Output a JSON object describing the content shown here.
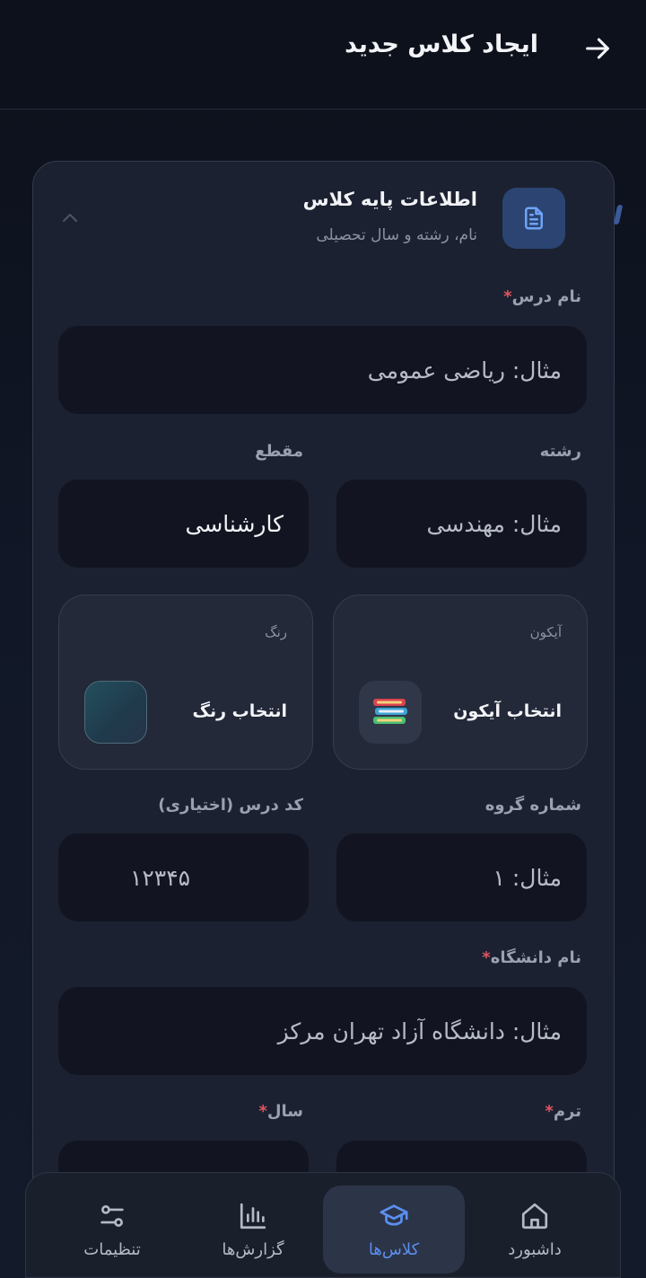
{
  "header": {
    "title": "ایجاد کلاس جدید",
    "back_icon": "arrow-right-icon"
  },
  "section": {
    "title": "اطلاعات پایه کلاس",
    "subtitle": "نام، رشته و سال تحصیلی",
    "icon": "document-icon",
    "collapse_icon": "chevron-up-icon"
  },
  "fields": {
    "course_name": {
      "label": "نام درس",
      "required": "*",
      "placeholder": "مثال: ریاضی عمومی"
    },
    "major": {
      "label": "رشته",
      "placeholder": "مثال: مهندسی"
    },
    "level": {
      "label": "مقطع",
      "value": "کارشناسی"
    },
    "group_number": {
      "label": "شماره گروه",
      "placeholder": "مثال: ۱"
    },
    "course_code": {
      "label": "کد درس (اختیاری)",
      "placeholder": "۱۲۳۴۵"
    },
    "university": {
      "label": "نام دانشگاه",
      "required": "*",
      "placeholder": "مثال: دانشگاه آزاد تهران مرکز"
    },
    "term": {
      "label": "ترم",
      "required": "*"
    },
    "year": {
      "label": "سال",
      "required": "*"
    }
  },
  "icon_picker": {
    "label": "آیکون",
    "action": "انتخاب آیکون",
    "selected_icon": "books-icon"
  },
  "color_picker": {
    "label": "رنگ",
    "action": "انتخاب رنگ",
    "selected_color": "#23505e"
  },
  "colors": {
    "accent": "#5b8ff0",
    "required": "#e05561",
    "background": "#0f1422",
    "card": "#1b2130",
    "field": "#121521"
  },
  "nav": {
    "items": [
      {
        "label": "داشبورد",
        "icon": "home-icon"
      },
      {
        "label": "کلاس‌ها",
        "icon": "graduation-cap-icon",
        "active": true
      },
      {
        "label": "گزارش‌ها",
        "icon": "bar-chart-icon"
      },
      {
        "label": "تنظیمات",
        "icon": "sliders-icon"
      }
    ]
  }
}
